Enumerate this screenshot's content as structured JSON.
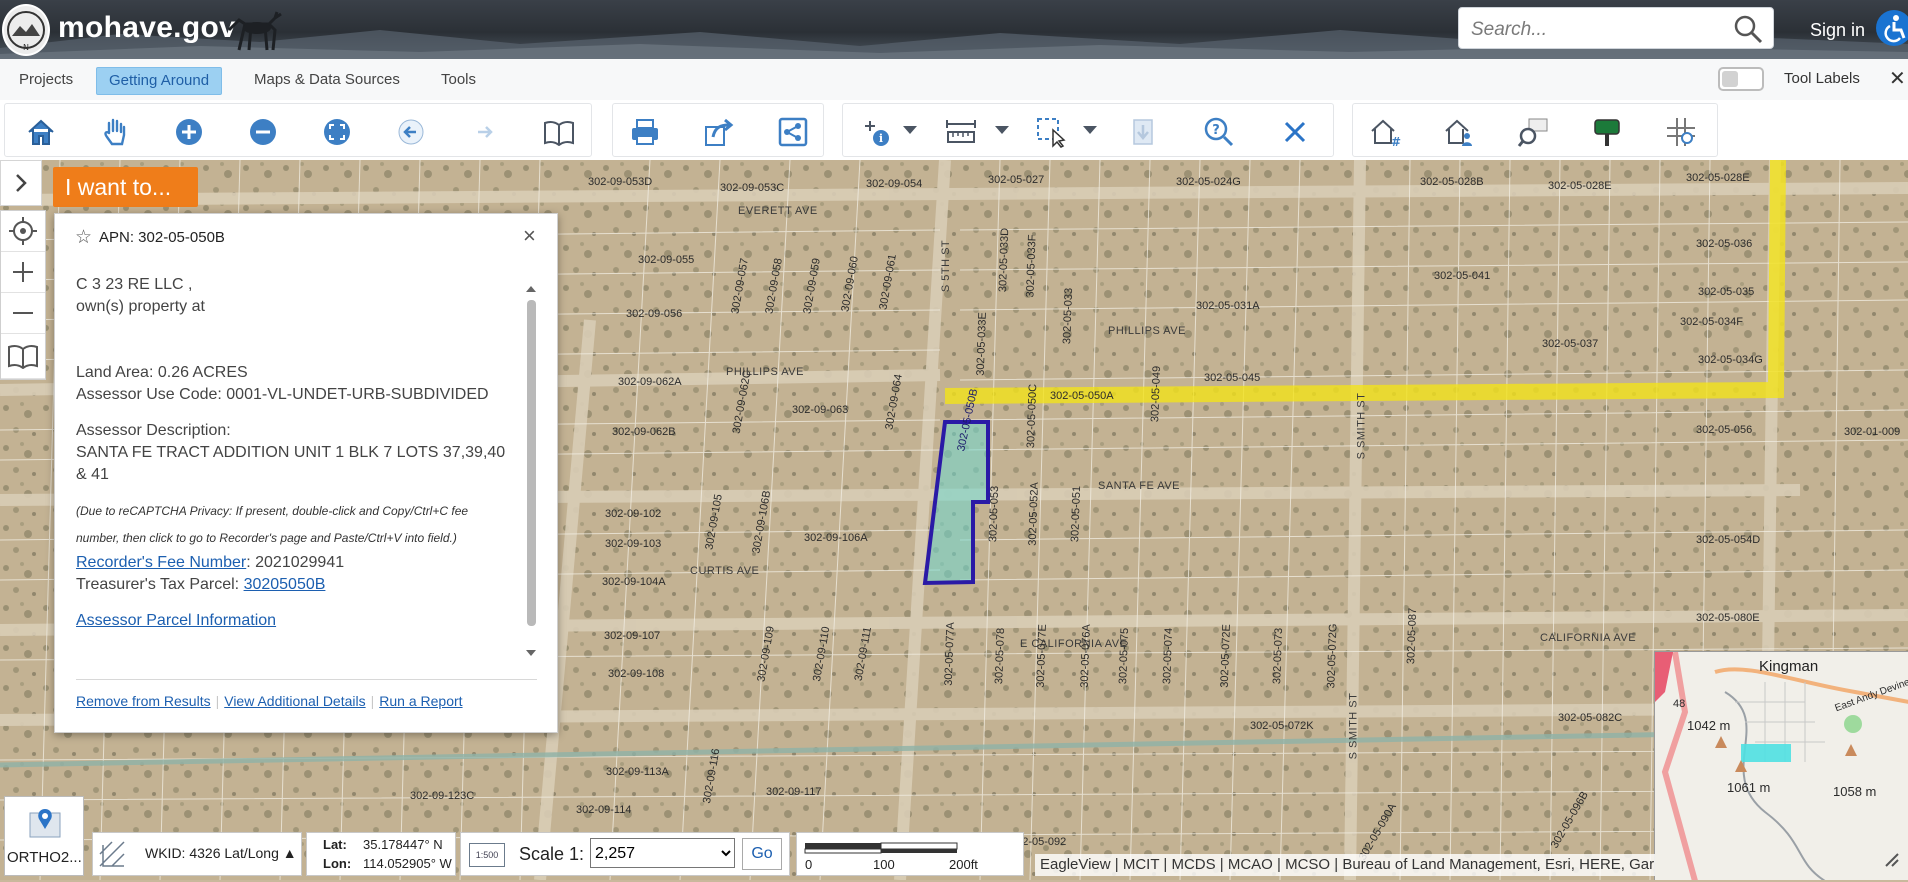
{
  "header": {
    "site_name": "mohave.gov",
    "search_placeholder": "Search...",
    "sign_in": "Sign in"
  },
  "menu": {
    "items": [
      "Projects",
      "Getting Around",
      "Maps & Data Sources",
      "Tools"
    ],
    "active": "Getting Around",
    "tool_labels": "Tool Labels",
    "close": "✕"
  },
  "map": {
    "i_want_to": "I want to...",
    "parcel_labels": [
      "302-09-053D",
      "302-09-053C",
      "302-09-054",
      "302-05-027",
      "302-05-024G",
      "302-05-028B",
      "302-05-028E",
      "302-05-028E",
      "302-09-055",
      "302-09-056",
      "302-09-057",
      "302-09-058",
      "302-09-059",
      "302-09-060",
      "302-09-061",
      "302-09-062A",
      "302-09-062B",
      "302-09-062C",
      "302-09-063",
      "302-09-064",
      "302-05-033E",
      "302-05-033D",
      "302-05-033F",
      "302-05-033",
      "302-05-031A",
      "302-05-041",
      "302-05-037",
      "302-05-036",
      "302-05-035",
      "302-05-034F",
      "302-05-034G",
      "302-09-102",
      "302-09-103",
      "302-09-104A",
      "302-09-105",
      "302-09-106B",
      "302-09-106A",
      "302-05-053",
      "302-05-052A",
      "302-05-051",
      "302-05-050A",
      "302-05-049",
      "302-05-045",
      "302-05-050C",
      "302-05-056",
      "302-01-009",
      "302-05-054D",
      "302-05-080E",
      "302-09-107",
      "302-09-108",
      "302-09-109",
      "302-09-110",
      "302-09-111",
      "302-05-077A",
      "302-05-078",
      "302-05-077E",
      "302-05-076A",
      "302-05-075",
      "302-05-074",
      "302-05-072E",
      "302-05-073",
      "302-05-072G",
      "302-05-087",
      "302-05-072K",
      "302-05-082C",
      "302-09-113A",
      "302-09-116",
      "302-09-117",
      "302-09-114",
      "302-09-123C",
      "302-05-092",
      "302-05-090A",
      "302-05-096B",
      "302-05-050B"
    ],
    "streets": [
      "EVERETT AVE",
      "PHILLIPS AVE",
      "PHILLIPS AVE",
      "SANTA FE AVE",
      "CURTIS AVE",
      "E CALIFORNIA AVE",
      "CALIFORNIA AVE",
      "S 5TH ST",
      "S SMITH ST",
      "S SMITH ST"
    ],
    "overview": {
      "city": "Kingman",
      "road": "East Andy Devine",
      "elev1": "1042 m",
      "elev2": "1061 m",
      "elev3": "1058 m",
      "route": "48"
    }
  },
  "popup": {
    "title": "APN: 302-05-050B",
    "owner_line1": "C 3 23 RE LLC ,",
    "owner_line2": "own(s) property at",
    "land_area": "Land Area: 0.26 ACRES",
    "use_code": "Assessor Use Code: 0001-VL-UNDET-URB-SUBDIVIDED",
    "desc_label": "Assessor Description:",
    "description": "SANTA FE TRACT ADDITION UNIT 1 BLK 7 LOTS 37,39,40 & 41",
    "note": "(Due to reCAPTCHA Privacy: If present, double-click and Copy/Ctrl+C fee number, then click to go to Recorder's page and Paste/Ctrl+V into field.)",
    "fee_label": "Recorder's Fee Number",
    "fee_value": ": 2021029941",
    "tax_label": "Treasurer's Tax Parcel: ",
    "tax_value": "30205050B",
    "assessor_link": "Assessor Parcel Information",
    "footer": [
      "Remove from Results",
      "View Additional Details",
      "Run a Report"
    ]
  },
  "bottom": {
    "basemap": "ORTHO2...",
    "wkid": "WKID: 4326 Lat/Long ▲",
    "lat_label": "Lat:",
    "lat_value": "35.178447° N",
    "lon_label": "Lon:",
    "lon_value": "114.052905° W",
    "scale_icon": "1:500",
    "scale_label": "Scale 1:",
    "scale_value": "2,257",
    "go": "Go",
    "scalebar": [
      "0",
      "100",
      "200ft"
    ],
    "attribution": "EagleView | MCIT | MCDS | MCAO | MCSO | Bureau of Land Management, Esri, HERE, Garmin"
  },
  "colors": {
    "accent_orange": "#ef7d1a",
    "active_tab": "#9cd0f2",
    "link_blue": "#1c5fb0",
    "selected_parcel": "#2a1aa6",
    "highlight_road": "#f3e21a"
  }
}
